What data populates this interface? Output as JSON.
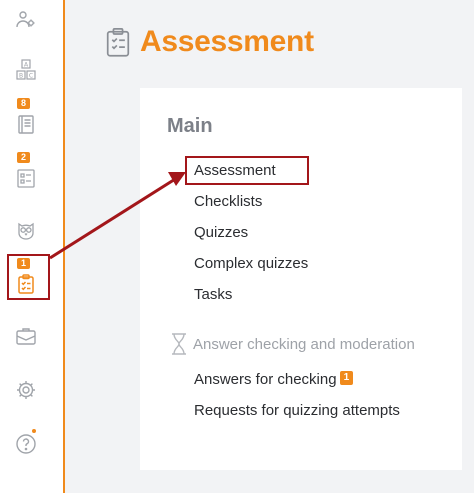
{
  "header": {
    "title": "Assessment",
    "icon": "clipboard-check-icon"
  },
  "sidebar": {
    "items": [
      {
        "id": "people-settings",
        "icon": "people-gear-icon",
        "badge": ""
      },
      {
        "id": "abc",
        "icon": "abc-blocks-icon",
        "badge": ""
      },
      {
        "id": "courses",
        "icon": "book-icon",
        "badge": "8"
      },
      {
        "id": "tests",
        "icon": "test-sheet-icon",
        "badge": "2"
      },
      {
        "id": "owl",
        "icon": "owl-icon",
        "badge": ""
      },
      {
        "id": "assessment",
        "icon": "clipboard-check-icon",
        "badge": "1"
      },
      {
        "id": "briefcase",
        "icon": "briefcase-icon",
        "badge": ""
      },
      {
        "id": "settings",
        "icon": "gear-icon",
        "badge": ""
      },
      {
        "id": "help",
        "icon": "question-circle-icon",
        "badge": ""
      }
    ],
    "accent": "#f08a1c"
  },
  "panel": {
    "section_title": "Main",
    "links": [
      {
        "label": "Assessment"
      },
      {
        "label": "Checklists"
      },
      {
        "label": "Quizzes"
      },
      {
        "label": "Complex quizzes"
      },
      {
        "label": "Tasks"
      }
    ],
    "moderation": {
      "title": "Answer checking and moderation",
      "icon": "hourglass-icon",
      "links": [
        {
          "label": "Answers for checking",
          "badge": "1"
        },
        {
          "label": "Requests for quizzing attempts"
        }
      ]
    }
  },
  "colors": {
    "accent": "#f08a1c",
    "highlight": "#a3161a",
    "background": "#f2f3f5"
  }
}
